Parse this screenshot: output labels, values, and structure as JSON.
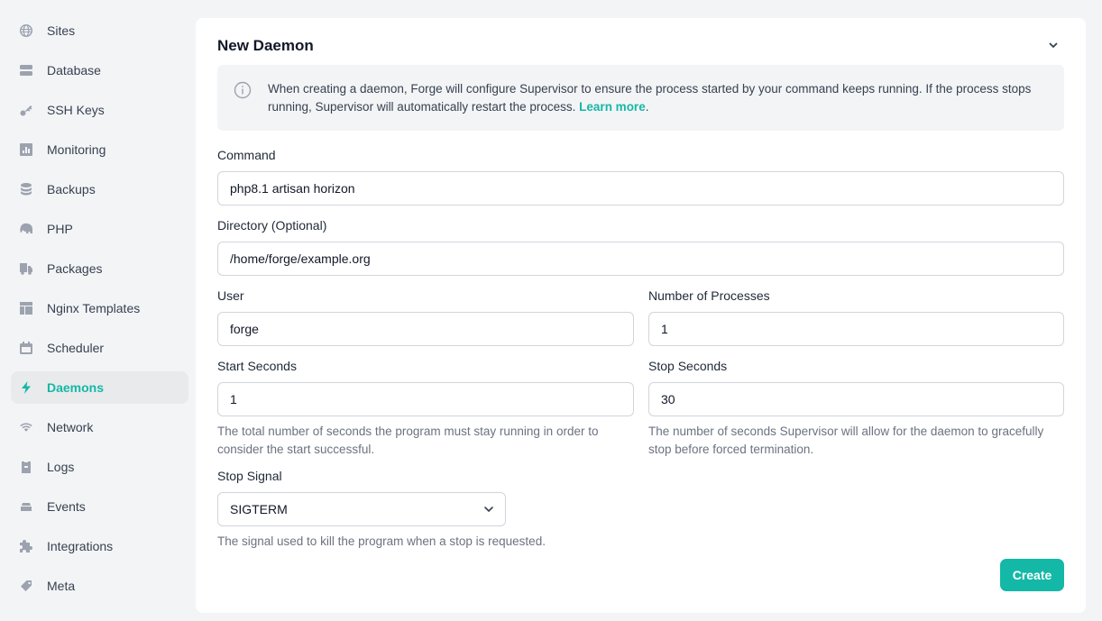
{
  "sidebar": {
    "items": [
      {
        "label": "Sites",
        "icon": "globe-icon"
      },
      {
        "label": "Database",
        "icon": "database-icon"
      },
      {
        "label": "SSH Keys",
        "icon": "key-icon"
      },
      {
        "label": "Monitoring",
        "icon": "chart-bar-icon"
      },
      {
        "label": "Backups",
        "icon": "stack-icon"
      },
      {
        "label": "PHP",
        "icon": "elephant-icon"
      },
      {
        "label": "Packages",
        "icon": "truck-icon"
      },
      {
        "label": "Nginx Templates",
        "icon": "template-icon"
      },
      {
        "label": "Scheduler",
        "icon": "calendar-icon"
      },
      {
        "label": "Daemons",
        "icon": "bolt-icon",
        "active": true
      },
      {
        "label": "Network",
        "icon": "wifi-icon"
      },
      {
        "label": "Logs",
        "icon": "clipboard-icon"
      },
      {
        "label": "Events",
        "icon": "inbox-icon"
      },
      {
        "label": "Integrations",
        "icon": "puzzle-icon"
      },
      {
        "label": "Meta",
        "icon": "tag-icon"
      }
    ]
  },
  "card": {
    "title": "New Daemon",
    "info": {
      "text": "When creating a daemon, Forge will configure Supervisor to ensure the process started by your command keeps running. If the process stops running, Supervisor will automatically restart the process.",
      "link": "Learn more",
      "trailing": "."
    },
    "command": {
      "label": "Command",
      "value": "php8.1 artisan horizon"
    },
    "directory": {
      "label": "Directory (Optional)",
      "value": "/home/forge/example.org"
    },
    "user": {
      "label": "User",
      "value": "forge"
    },
    "processes": {
      "label": "Number of Processes",
      "value": "1"
    },
    "start_seconds": {
      "label": "Start Seconds",
      "value": "1",
      "help": "The total number of seconds the program must stay running in order to consider the start successful."
    },
    "stop_seconds": {
      "label": "Stop Seconds",
      "value": "30",
      "help": "The number of seconds Supervisor will allow for the daemon to gracefully stop before forced termination."
    },
    "stop_signal": {
      "label": "Stop Signal",
      "value": "SIGTERM",
      "help": "The signal used to kill the program when a stop is requested."
    },
    "create_label": "Create"
  },
  "colors": {
    "accent": "#14b8a6",
    "background": "#f3f4f6"
  }
}
